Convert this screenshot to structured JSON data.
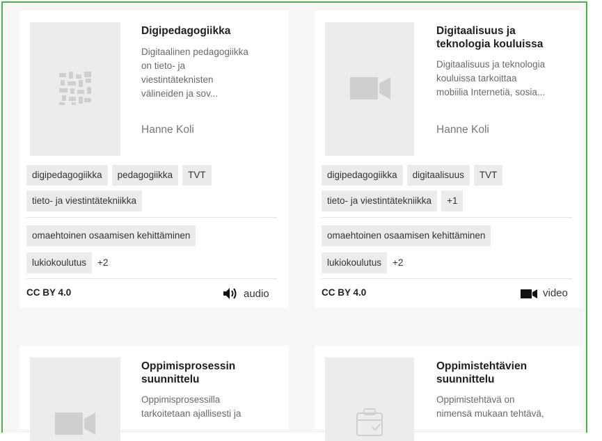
{
  "cards": [
    {
      "title": "Digipedagogiikka",
      "desc_lines": [
        "Digitaalinen pedagogiikka",
        "on tieto- ja",
        "viestintäteknisten",
        "välineiden ja sov..."
      ],
      "author": "Hanne Koli",
      "thumb_icon": "qr-placeholder-icon",
      "tags_row1": [
        "digipedagogiikka",
        "pedagogiikka",
        "TVT"
      ],
      "tags_row2": [
        "tieto- ja viestintätekniikka"
      ],
      "tags_row3": [
        "omaehtoinen osaamisen kehittäminen"
      ],
      "tags_row4": [
        "lukiokoulutus",
        "+2"
      ],
      "license": "CC BY 4.0",
      "media_label": "audio",
      "media_icon": "speaker-icon"
    },
    {
      "title_lines": [
        "Digitaalisuus ja",
        "teknologia kouluissa"
      ],
      "desc_lines": [
        "Digitaalisuus ja teknologia",
        "kouluissa tarkoittaa",
        "mobiilia Internetiä, sosia..."
      ],
      "author": "Hanne Koli",
      "thumb_icon": "video-camera-icon",
      "tags_row1": [
        "digipedagogiikka",
        "digitaalisuus",
        "TVT"
      ],
      "tags_row2": [
        "tieto- ja viestintätekniikka",
        "+1"
      ],
      "tags_row3": [
        "omaehtoinen osaamisen kehittäminen"
      ],
      "tags_row4": [
        "lukiokoulutus",
        "+2"
      ],
      "license": "CC BY 4.0",
      "media_label": "video",
      "media_icon": "video-camera-icon"
    },
    {
      "title_lines": [
        "Oppimisprosessin",
        "suunnittelu"
      ],
      "desc_lines": [
        "Oppimisprosessilla",
        "tarkoitetaan ajallisesti ja"
      ],
      "thumb_icon": "video-camera-icon"
    },
    {
      "title_lines": [
        "Oppimistehtävien",
        "suunnittelu"
      ],
      "desc_lines": [
        "Oppimistehtävä on",
        "nimensä mukaan tehtävä,"
      ],
      "thumb_icon": "clipboard-check-icon"
    }
  ]
}
